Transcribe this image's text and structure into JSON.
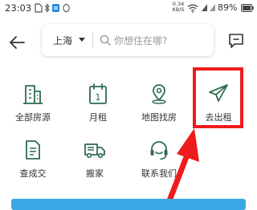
{
  "status_bar": {
    "time": "23:03",
    "net_speed_value": "0.34",
    "net_speed_unit": "KB/S",
    "battery": "89%"
  },
  "header": {
    "city": "上海",
    "search_placeholder": "你想住在哪?"
  },
  "menu": {
    "row1": [
      {
        "label": "全部房源",
        "icon": "building-icon"
      },
      {
        "label": "月租",
        "icon": "calendar-icon"
      },
      {
        "label": "地图找房",
        "icon": "map-pin-icon"
      },
      {
        "label": "去出租",
        "icon": "paper-plane-icon"
      }
    ],
    "row2": [
      {
        "label": "查成交",
        "icon": "document-icon"
      },
      {
        "label": "搬家",
        "icon": "truck-icon"
      },
      {
        "label": "联系我们",
        "icon": "headset-icon"
      }
    ],
    "calendar_day": "1"
  },
  "colors": {
    "icon": "#2f6b4f",
    "highlight": "#ee1c1c",
    "banner": "#3aa9e6"
  }
}
